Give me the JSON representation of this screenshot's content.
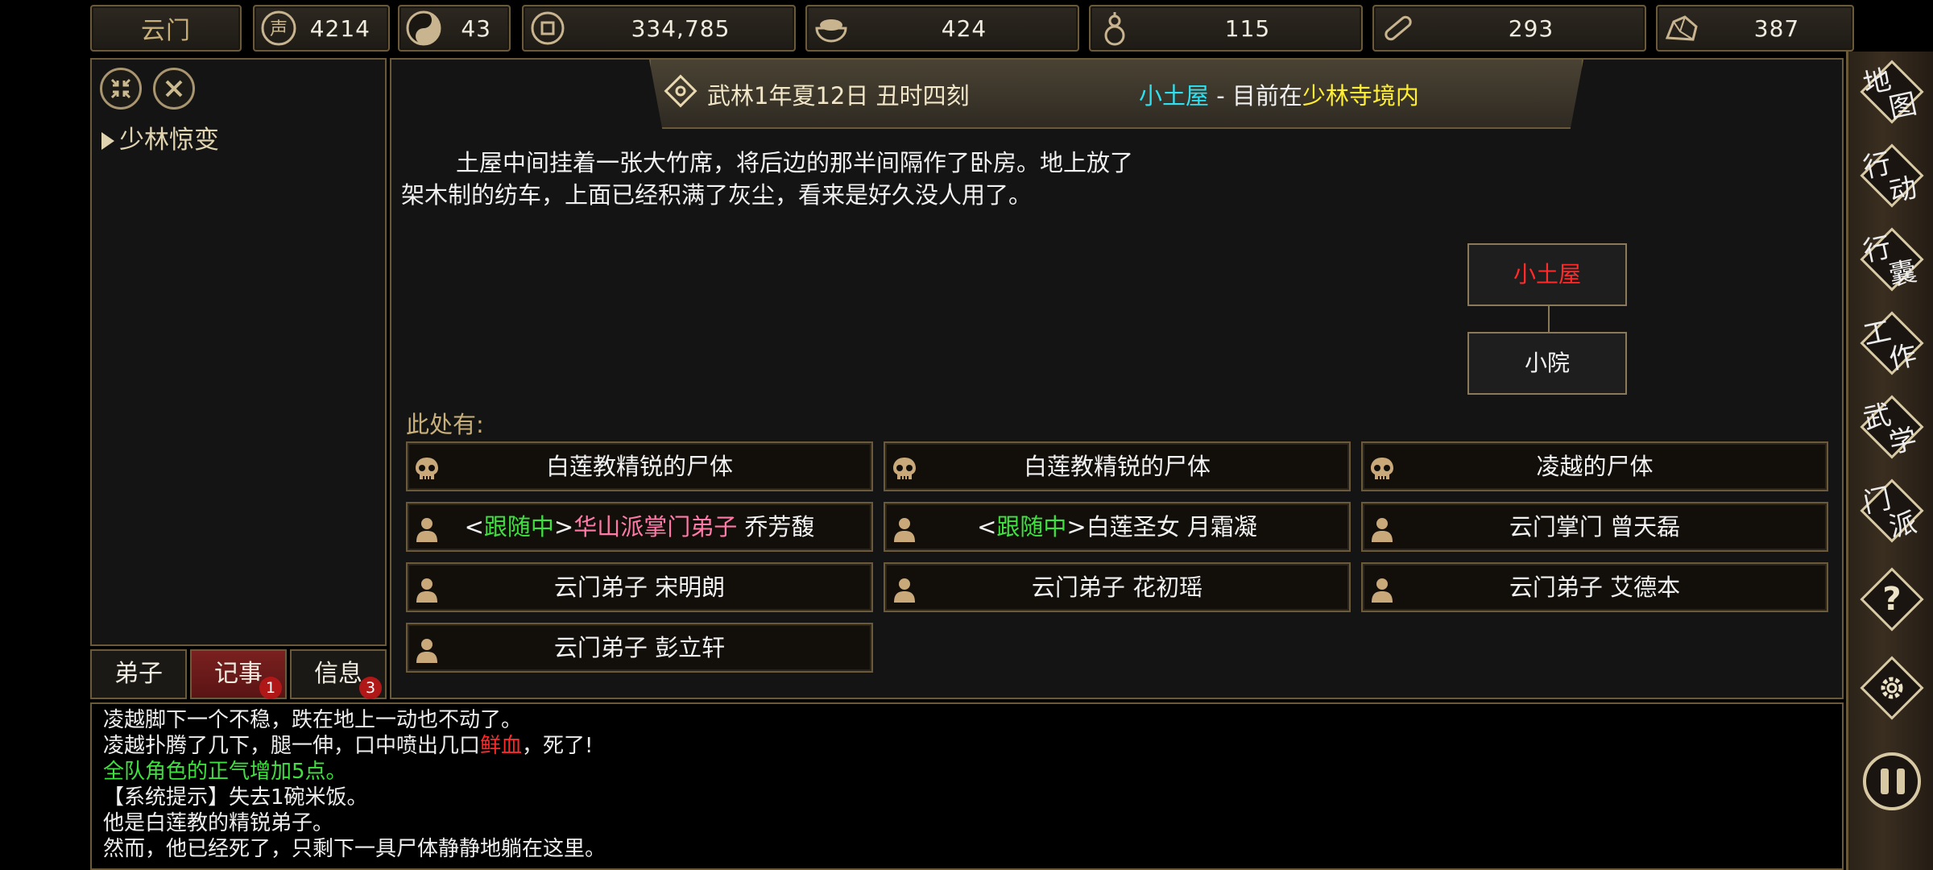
{
  "resources": {
    "sect_name": "云门",
    "reputation": "4214",
    "yinyang": "43",
    "money": "334,785",
    "food": "424",
    "medicine": "115",
    "wood": "293",
    "stone": "387"
  },
  "left_panel": {
    "quest_title": "少林惊变"
  },
  "tabs": [
    {
      "label": "弟子",
      "badge": ""
    },
    {
      "label": "记事",
      "badge": "1"
    },
    {
      "label": "信息",
      "badge": "3"
    }
  ],
  "banner": {
    "datetime": "武林1年夏12日 丑时四刻",
    "location": "小土屋",
    "sep": " - 目前在",
    "region": "少林寺境内"
  },
  "description": {
    "line1": "土屋中间挂着一张大竹席，将后边的那半间隔作了卧房。地上放了",
    "line2": "架木制的纺车，上面已经积满了灰尘，看来是好久没人用了。"
  },
  "minimap": {
    "current": "小土屋",
    "south": "小院"
  },
  "here_label": "此处有:",
  "entities": [
    {
      "kind": "skull",
      "text": "白莲教精锐的尸体"
    },
    {
      "kind": "skull",
      "text": "白莲教精锐的尸体"
    },
    {
      "kind": "skull",
      "text": "凌越的尸体"
    },
    {
      "kind": "person",
      "pre": "<",
      "follow": "跟随中",
      "mid": ">",
      "faction": "华山派掌门弟子",
      "name": " 乔芳馥"
    },
    {
      "kind": "person",
      "pre": "<",
      "follow": "跟随中",
      "mid": ">",
      "faction": "",
      "name": "白莲圣女 月霜凝"
    },
    {
      "kind": "person",
      "text": "云门掌门 曾天磊"
    },
    {
      "kind": "person",
      "text": "云门弟子 宋明朗"
    },
    {
      "kind": "person",
      "text": "云门弟子 花初瑶"
    },
    {
      "kind": "person",
      "text": "云门弟子 艾德本"
    },
    {
      "kind": "person",
      "text": "云门弟子 彭立轩"
    }
  ],
  "log": {
    "l1": "凌越脚下一个不稳，跌在地上一动也不动了。",
    "l2a": "凌越扑腾了几下，腿一伸，口中喷出几口",
    "l2b": "鲜血",
    "l2c": "，死了!",
    "l3": "全队角色的正气增加5点。",
    "l4": "【系统提示】失去1碗米饭。",
    "l5": "他是白莲教的精锐弟子。",
    "l6": "然而，他已经死了，只剩下一具尸体静静地躺在这里。"
  },
  "right_menu": {
    "map": [
      "地",
      "图"
    ],
    "action": [
      "行",
      "动"
    ],
    "bag": [
      "行",
      "囊"
    ],
    "work": [
      "工",
      "作"
    ],
    "martial": [
      "武",
      "学"
    ],
    "sect": [
      "门",
      "派"
    ],
    "help": "?"
  },
  "colors": {
    "follow": "#3fe03f",
    "faction": "#ff7aa8",
    "location": "#30e0f0",
    "region": "#ffee33",
    "current_room": "#ff2a2a",
    "gold_border": "#6b5a3a"
  }
}
